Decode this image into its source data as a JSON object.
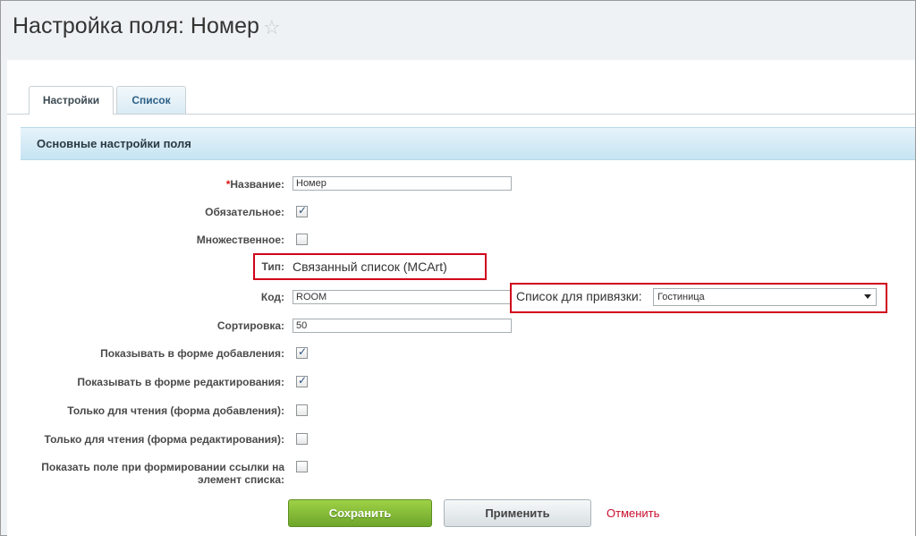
{
  "page": {
    "title": "Настройка поля: Номер"
  },
  "tabs": [
    {
      "label": "Настройки",
      "active": true
    },
    {
      "label": "Список",
      "active": false
    }
  ],
  "section": {
    "title": "Основные настройки поля"
  },
  "fields": {
    "name": {
      "required_mark": "*",
      "label": "Название:",
      "value": "Номер"
    },
    "required": {
      "label": "Обязательное:",
      "checked": true
    },
    "multiple": {
      "label": "Множественное:",
      "checked": false
    },
    "type": {
      "label": "Тип:",
      "value": "Связанный список (MCArt)"
    },
    "code": {
      "label": "Код:",
      "value": "ROOM"
    },
    "link_list": {
      "label": "Список для привязки:",
      "value": "Гостиница"
    },
    "sort": {
      "label": "Сортировка:",
      "value": "50"
    },
    "show_add": {
      "label": "Показывать в форме добавления:",
      "checked": true
    },
    "show_edit": {
      "label": "Показывать в форме редактирования:",
      "checked": true
    },
    "readonly_add": {
      "label": "Только для чтения (форма добавления):",
      "checked": false
    },
    "readonly_edit": {
      "label": "Только для чтения (форма редактирования):",
      "checked": false
    },
    "show_link": {
      "label_line1": "Показать поле при формировании ссылки на",
      "label_line2": "элемент списка:",
      "checked": false
    }
  },
  "buttons": {
    "save": "Сохранить",
    "apply": "Применить",
    "cancel": "Отменить"
  },
  "colors": {
    "highlight": "#d0021b",
    "save_button": "#7cb82f",
    "cancel_link": "#c8102e"
  }
}
